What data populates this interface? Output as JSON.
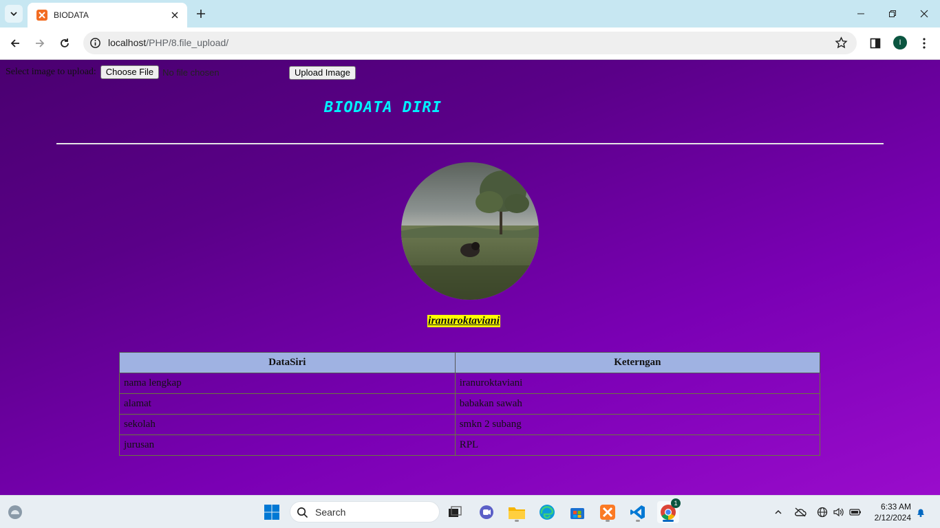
{
  "browser": {
    "tab_title": "BIODATA",
    "url_host": "localhost",
    "url_path": "/PHP/8.file_upload/",
    "profile_initial": "I"
  },
  "upload": {
    "label": "Select image to upload:",
    "choose_label": "Choose File",
    "file_status": "No file chosen",
    "submit_label": "Upload Image"
  },
  "page": {
    "title": "BIODATA DIRI",
    "username": "iranuroktaviani"
  },
  "table": {
    "headers": [
      "DataSiri",
      "Keterngan"
    ],
    "rows": [
      [
        "nama lengkap",
        "iranuroktaviani"
      ],
      [
        "alamat",
        "babakan sawah"
      ],
      [
        "sekolah",
        "smkn 2 subang"
      ],
      [
        "jurusan",
        "RPL"
      ]
    ]
  },
  "taskbar": {
    "search_placeholder": "Search",
    "time": "6:33 AM",
    "date": "2/12/2024",
    "chrome_badge": "1"
  },
  "colors": {
    "page_gradient_top": "#4a0070",
    "page_gradient_bottom": "#9a0ccc",
    "title": "#00f0ff",
    "username_highlight": "#ffff00",
    "table_header": "#9fb2e2"
  }
}
